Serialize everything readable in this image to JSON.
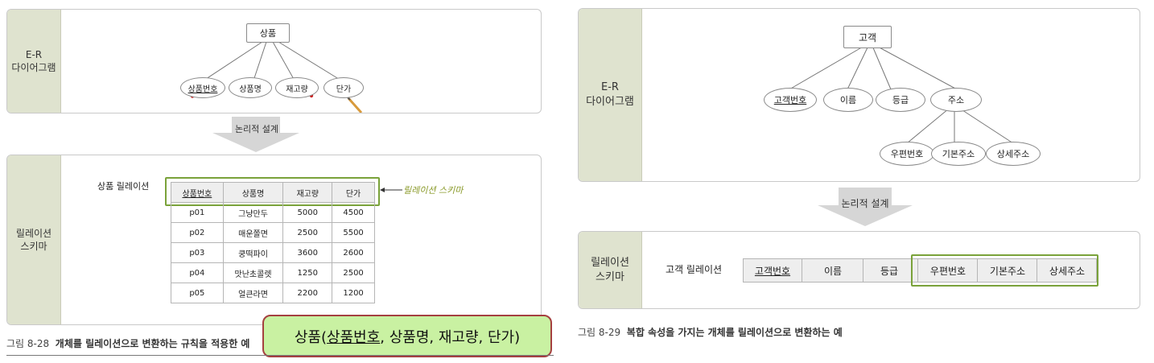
{
  "left": {
    "er_label": [
      "E-R",
      "다이어그램"
    ],
    "entity": "상품",
    "attributes": [
      "상품번호",
      "상품명",
      "재고량",
      "단가"
    ],
    "design_label": "논리적 설계",
    "schema_label": [
      "릴레이션",
      "스키마"
    ],
    "relation_name": "상품 릴레이션",
    "table": {
      "headers": [
        "상품번호",
        "상품명",
        "재고량",
        "단가"
      ],
      "rows": [
        [
          "p01",
          "그냥만두",
          "5000",
          "4500"
        ],
        [
          "p02",
          "매운쫄면",
          "2500",
          "5500"
        ],
        [
          "p03",
          "쿵떡파이",
          "3600",
          "2600"
        ],
        [
          "p04",
          "맛난초콜렛",
          "1250",
          "2500"
        ],
        [
          "p05",
          "얼큰라면",
          "2200",
          "1200"
        ]
      ]
    },
    "schema_note": "릴레이션 스키마",
    "caption_num": "그림 8-28",
    "caption_text": "개체를 릴레이션으로 변환하는 규칙을 적용한 예",
    "overlay": {
      "prefix": "상품(",
      "key": "상품번호",
      "rest": ", 상품명, 재고량, 단가)"
    }
  },
  "right": {
    "er_label": [
      "E-R",
      "다이어그램"
    ],
    "entity": "고객",
    "attributes": [
      "고객번호",
      "이름",
      "등급",
      "주소"
    ],
    "sub_attributes": [
      "우편번호",
      "기본주소",
      "상세주소"
    ],
    "design_label": "논리적 설계",
    "schema_label": [
      "릴레이션",
      "스키마"
    ],
    "relation_name": "고객 릴레이션",
    "columns": [
      "고객번호",
      "이름",
      "등급",
      "우편번호",
      "기본주소",
      "상세주소"
    ],
    "caption_num": "그림 8-29",
    "caption_text": "복합 속성을 가지는 개체를 릴레이션으로 변환하는 예"
  },
  "colors": {
    "side_panel": "#dfe3cf",
    "highlight": "#7aa23a",
    "note_fill": "#c9f1a2",
    "note_border": "#a54040"
  }
}
